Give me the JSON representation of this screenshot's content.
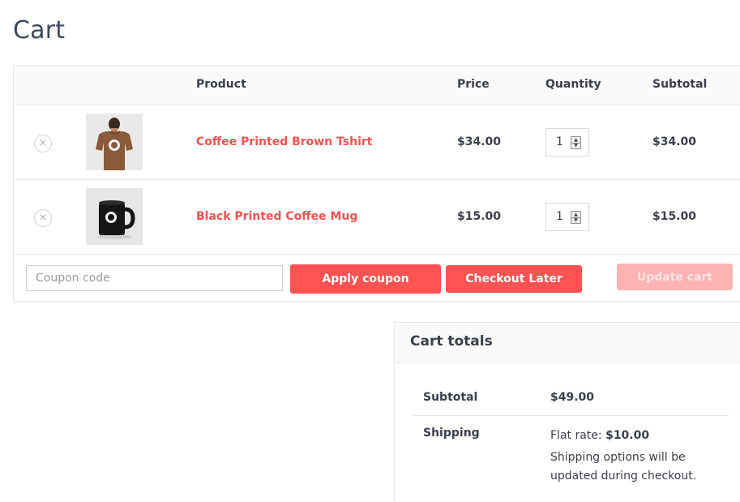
{
  "page": {
    "title": "Cart"
  },
  "table": {
    "headers": {
      "product": "Product",
      "price": "Price",
      "quantity": "Quantity",
      "subtotal": "Subtotal"
    },
    "items": [
      {
        "name": "Coffee Printed Brown Tshirt",
        "price": "$34.00",
        "quantity": "1",
        "subtotal": "$34.00",
        "remove": "×"
      },
      {
        "name": "Black Printed Coffee Mug",
        "price": "$15.00",
        "quantity": "1",
        "subtotal": "$15.00",
        "remove": "×"
      }
    ]
  },
  "actions": {
    "coupon_placeholder": "Coupon code",
    "apply_coupon": "Apply coupon",
    "checkout_later": "Checkout Later",
    "update_cart": "Update cart"
  },
  "totals": {
    "title": "Cart totals",
    "subtotal_label": "Subtotal",
    "subtotal_value": "$49.00",
    "shipping_label": "Shipping",
    "flat_rate_label": "Flat rate: ",
    "flat_rate_value": "$10.00",
    "shipping_note": "Shipping options will be updated during checkout."
  },
  "colors": {
    "accent": "#ff5252",
    "product_link": "#f05252",
    "disabled_button": "#ffb3b3"
  }
}
